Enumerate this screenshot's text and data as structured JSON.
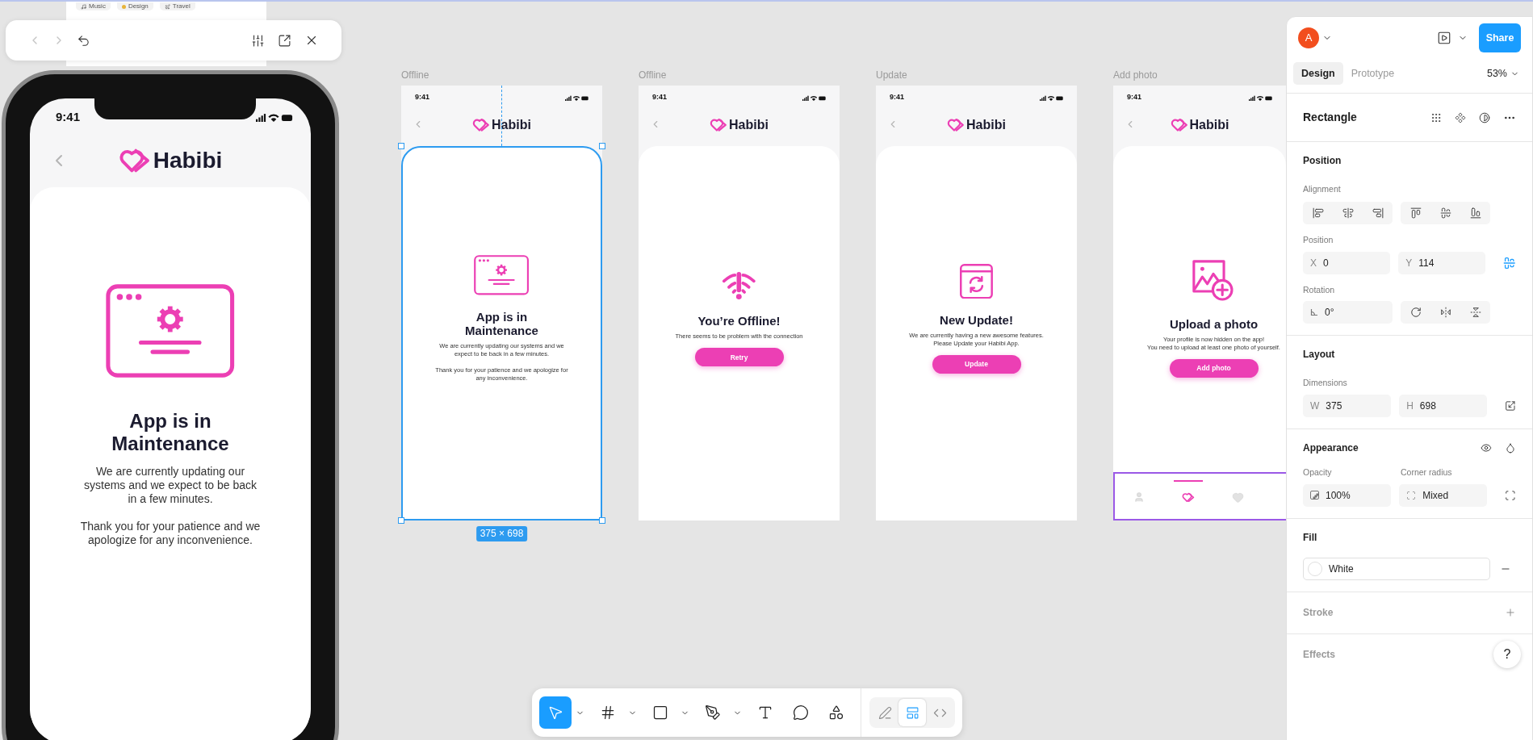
{
  "background_frame": {
    "tags": [
      "Music",
      "Design",
      "Travel"
    ]
  },
  "preview_toolbar": {
    "back_disabled": true,
    "forward_disabled": true
  },
  "preview_phone": {
    "time": "9:41",
    "brand": "Habibi",
    "kind": "maintenance",
    "title": "App is in Maintenance",
    "body": "We are currently updating our systems and we expect to be back in a few minutes.\n\nThank you for your patience and we apologize for any inconvenience."
  },
  "frames": [
    {
      "label": "Offline",
      "time": "9:41",
      "brand": "Habibi",
      "kind": "maintenance",
      "title": "App is in Maintenance",
      "body": "We are currently updating our systems and we expect to be back in a few minutes.\n\nThank you for your patience and we apologize for any inconvenience.",
      "selected": true,
      "size_label": "375 × 698"
    },
    {
      "label": "Offline",
      "time": "9:41",
      "brand": "Habibi",
      "kind": "offline",
      "title": "You’re Offline!",
      "body": "There seems to be problem with the connection",
      "button": "Retry",
      "selected": false
    },
    {
      "label": "Update",
      "time": "9:41",
      "brand": "Habibi",
      "kind": "update",
      "title": "New Update!",
      "body": "We are currently having a new awesome features.\nPlease Update your Habibi App.",
      "button": "Update",
      "selected": false
    },
    {
      "label": "Add photo",
      "time": "9:41",
      "brand": "Habibi",
      "kind": "upload",
      "title": "Upload a photo",
      "body": "Your profile is now hidden on the app!\nYou need to upload at least one photo of yourself.",
      "button": "Add photo",
      "selected": false,
      "tab_bar": {
        "hovered": true,
        "items": [
          {
            "kind": "person",
            "selected": false
          },
          {
            "kind": "logo",
            "selected": true
          },
          {
            "kind": "heart",
            "selected": false
          }
        ]
      }
    }
  ],
  "panel": {
    "avatar": "A",
    "share": "Share",
    "tabs": [
      {
        "label": "Design",
        "selected": true
      },
      {
        "label": "Prototype",
        "selected": false
      }
    ],
    "zoom": "53%",
    "layer_name": "Rectangle",
    "position": {
      "title": "Position",
      "alignment_label": "Alignment",
      "position_label": "Position",
      "x": {
        "label": "X",
        "value": "0"
      },
      "y": {
        "label": "Y",
        "value": "114"
      },
      "rotation_label": "Rotation",
      "rotation": "0°"
    },
    "layout": {
      "title": "Layout",
      "dimensions_label": "Dimensions",
      "w": {
        "label": "W",
        "value": "375"
      },
      "h": {
        "label": "H",
        "value": "698"
      }
    },
    "appearance": {
      "title": "Appearance",
      "opacity_label": "Opacity",
      "opacity": "100%",
      "corner_label": "Corner radius",
      "corner": "Mixed"
    },
    "fill": {
      "title": "Fill",
      "value": "White"
    },
    "stroke": "Stroke",
    "effects": "Effects",
    "help": "?"
  },
  "toolbar": {
    "tools": [
      {
        "kind": "move",
        "selected": true,
        "caret": true
      },
      {
        "kind": "frame",
        "selected": false,
        "caret": true
      },
      {
        "kind": "rectangle",
        "selected": false,
        "caret": true
      },
      {
        "kind": "pen",
        "selected": false,
        "caret": true
      },
      {
        "kind": "text",
        "selected": false,
        "caret": false
      },
      {
        "kind": "comment",
        "selected": false,
        "caret": false
      },
      {
        "kind": "actions",
        "selected": false,
        "caret": false
      }
    ],
    "modes": [
      {
        "kind": "draw",
        "selected": false
      },
      {
        "kind": "design",
        "selected": true
      },
      {
        "kind": "dev",
        "selected": false
      }
    ]
  }
}
